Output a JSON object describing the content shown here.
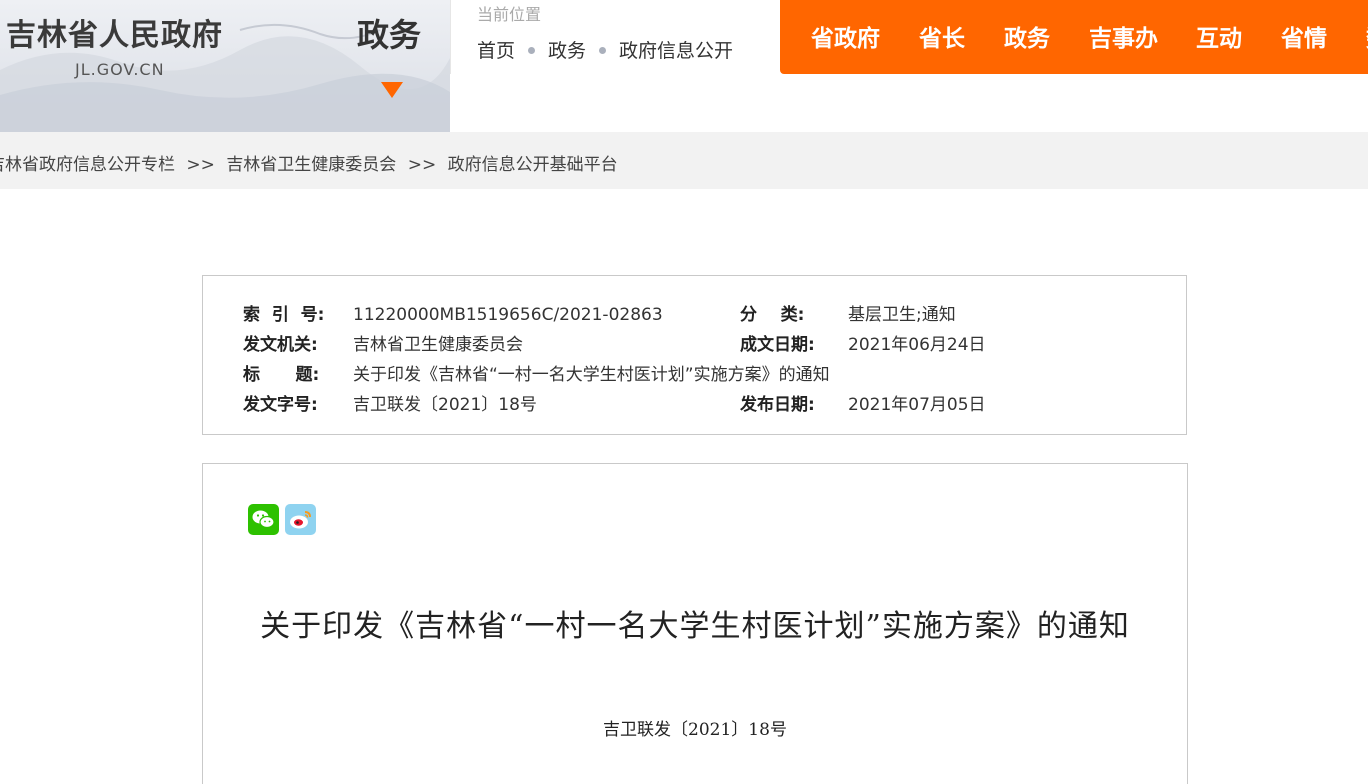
{
  "header": {
    "site_name": "吉林省人民政府",
    "site_domain": "JL.GOV.CN",
    "section_title": "政务",
    "location": {
      "label": "当前位置",
      "crumbs": [
        "首页",
        "政务",
        "政府信息公开"
      ]
    },
    "nav": [
      "省政府",
      "省长",
      "政务",
      "吉事办",
      "互动",
      "省情",
      "数"
    ],
    "accent_color": "#ff6600"
  },
  "breadcrumb": [
    "吉林省政府信息公开专栏",
    "吉林省卫生健康委员会",
    "政府信息公开基础平台"
  ],
  "breadcrumb_separator": ">>",
  "info": {
    "index_no": {
      "label": "索  引  号:",
      "value": "11220000MB1519656C/2021-02863"
    },
    "category": {
      "label": "分    类:",
      "value": "基层卫生;通知"
    },
    "issuer": {
      "label": "发文机关:",
      "value": "吉林省卫生健康委员会"
    },
    "date_written": {
      "label": "成文日期:",
      "value": "2021年06月24日"
    },
    "title": {
      "label": "标      题:",
      "value": "关于印发《吉林省“一村一名大学生村医计划”实施方案》的通知"
    },
    "doc_no": {
      "label": "发文字号:",
      "value": "吉卫联发〔2021〕18号"
    },
    "date_published": {
      "label": "发布日期:",
      "value": "2021年07月05日"
    }
  },
  "article": {
    "share_icons": [
      "wechat-icon",
      "weibo-icon"
    ],
    "title": "关于印发《吉林省“一村一名大学生村医计划”实施方案》的通知",
    "doc_number": "吉卫联发〔2021〕18号"
  }
}
